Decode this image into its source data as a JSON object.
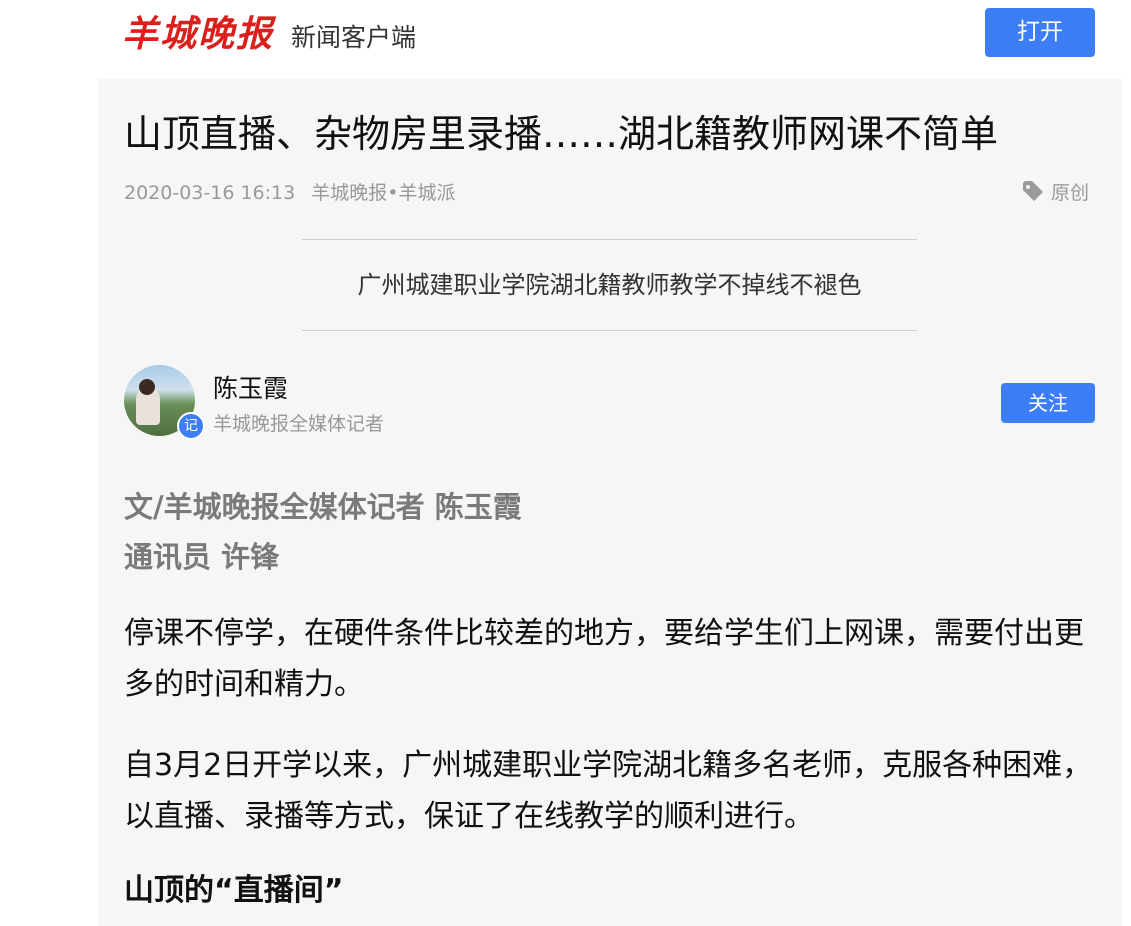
{
  "header": {
    "logo_text": "羊城晚报",
    "logo_subtitle": "新闻客户端",
    "open_button": "打开",
    "brand_color": "#d9201d",
    "accent_color": "#3d7df6"
  },
  "article": {
    "title": "山顶直播、杂物房里录播……湖北籍教师网课不简单",
    "datetime": "2020-03-16 16:13",
    "source": "羊城晚报•羊城派",
    "original_label": "原创",
    "original_icon": "tag-icon",
    "subtitle": "广州城建职业学院湖北籍教师教学不掉线不褪色"
  },
  "author": {
    "name": "陈玉霞",
    "role": "羊城晚报全媒体记者",
    "badge": "记",
    "follow_button": "关注"
  },
  "body": {
    "byline_1": "文/羊城晚报全媒体记者 陈玉霞",
    "byline_2": "通讯员 许锋",
    "paragraph_1": "停课不停学，在硬件条件比较差的地方，要给学生们上网课，需要付出更多的时间和精力。",
    "paragraph_2": "自3月2日开学以来，广州城建职业学院湖北籍多名老师，克服各种困难，以直播、录播等方式，保证了在线教学的顺利进行。",
    "section_heading": "山顶的“直播间”"
  }
}
